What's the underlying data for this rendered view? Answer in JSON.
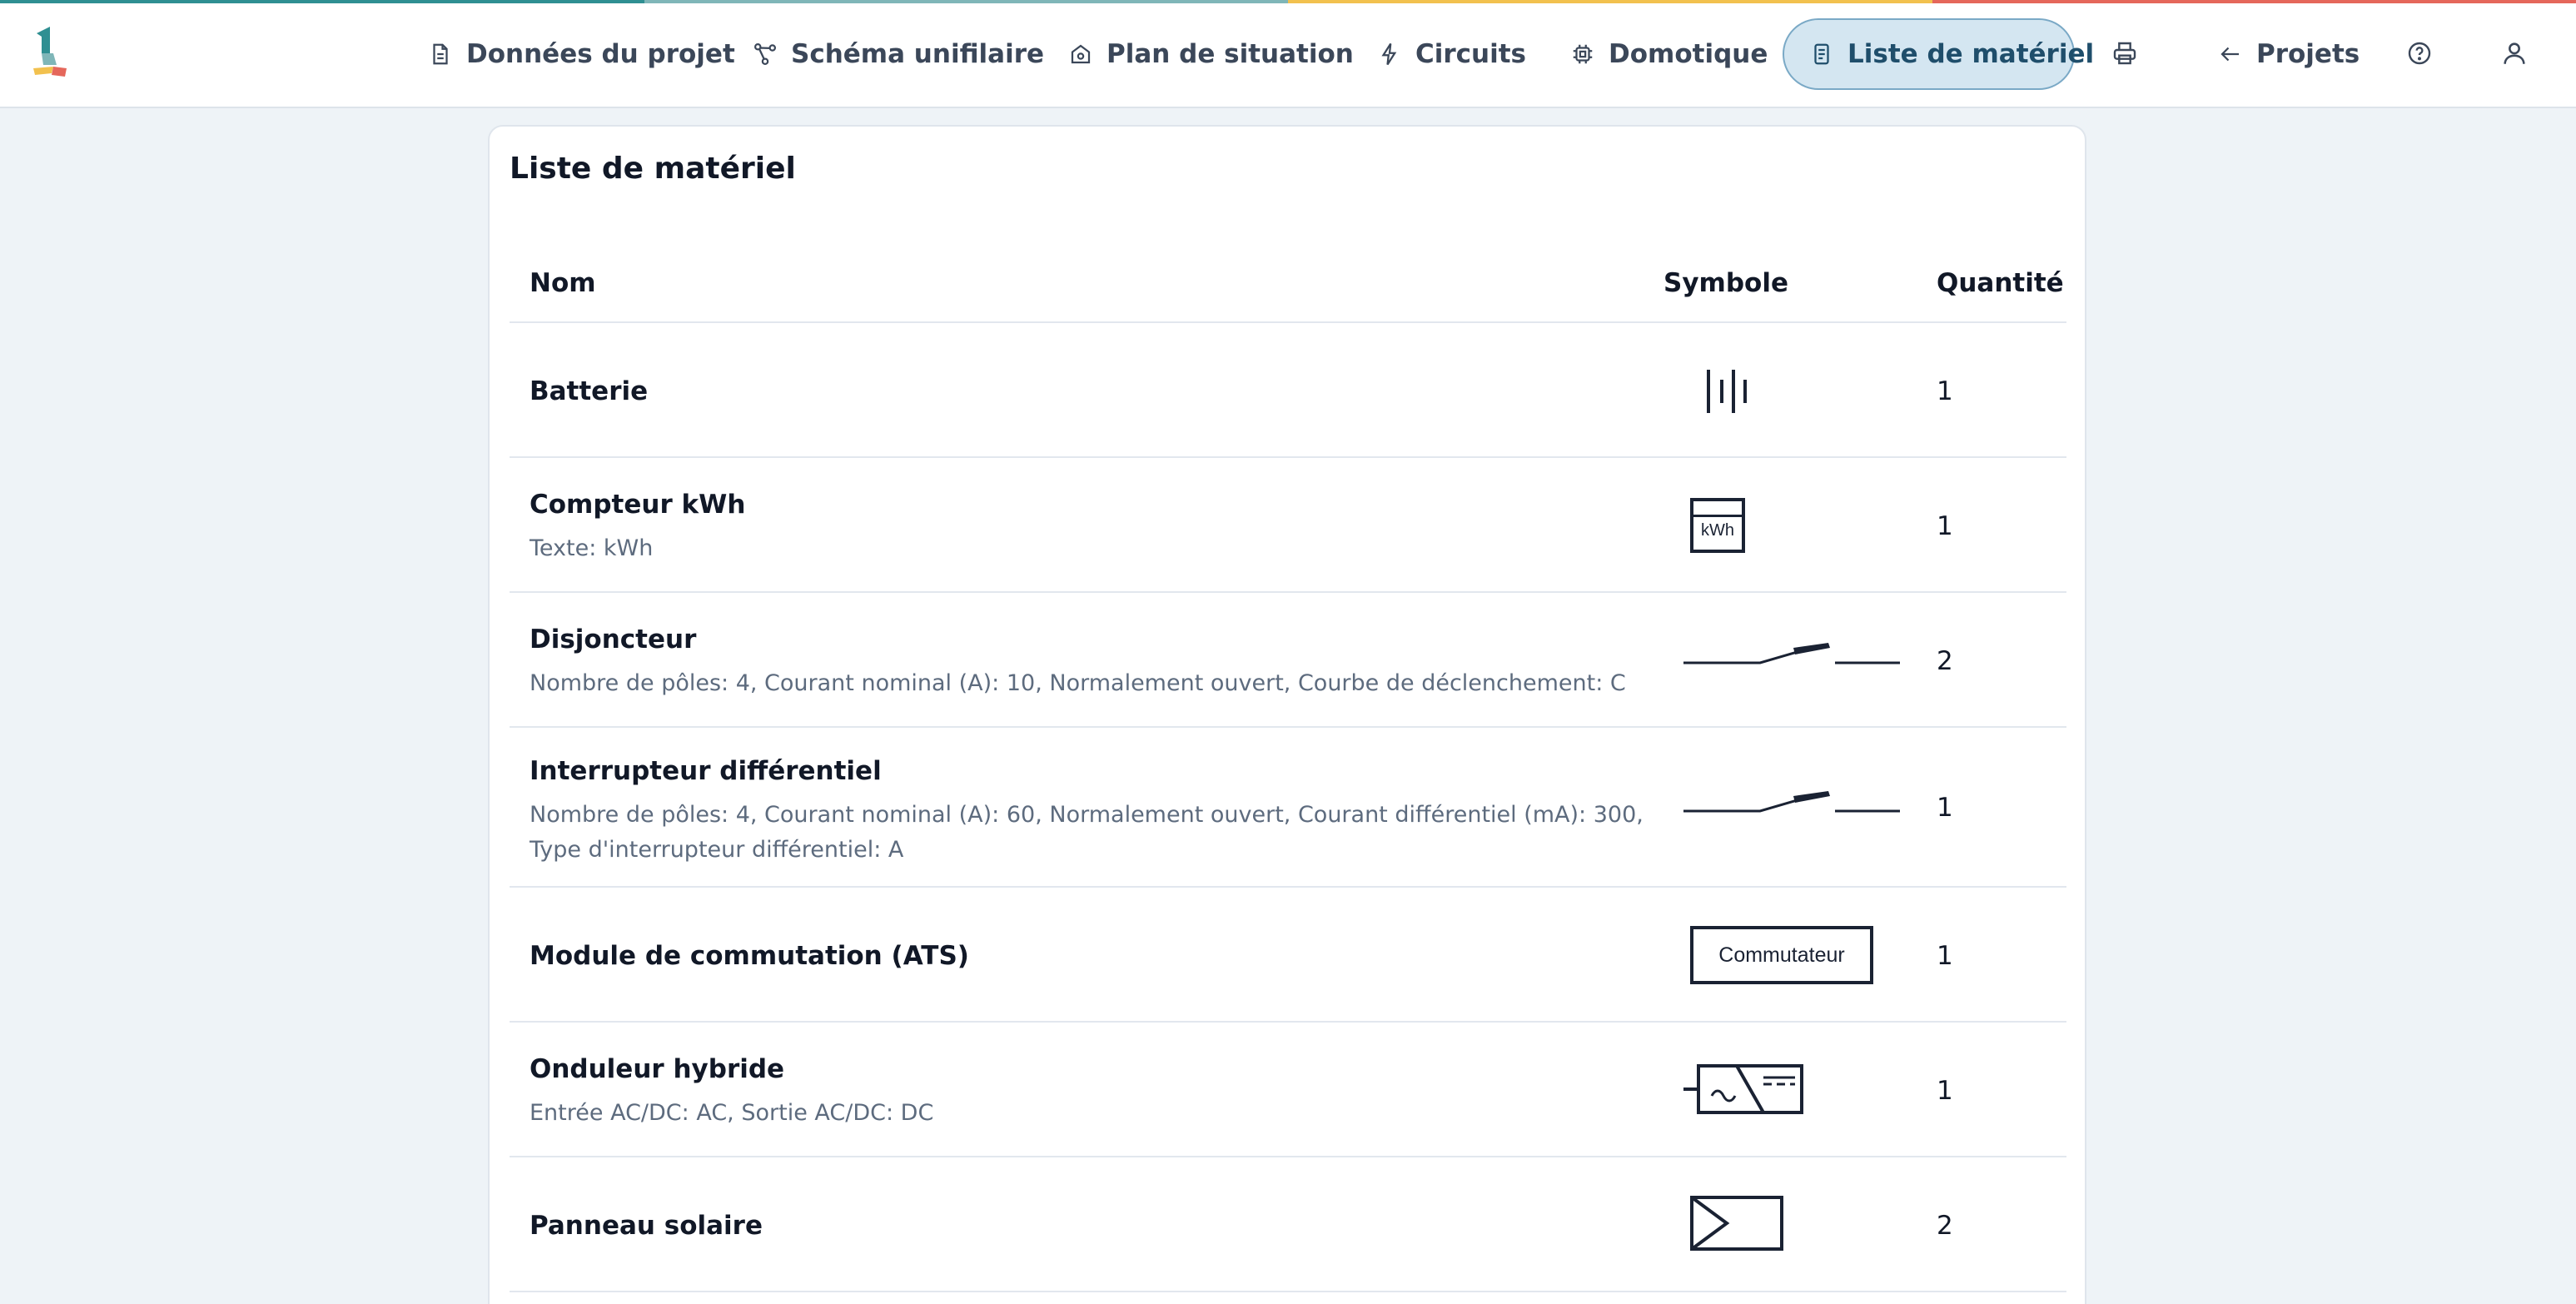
{
  "colors": {
    "accent": "#d4e6f1",
    "accent_border": "#7aa9c6",
    "logo_teal": "#2f8f92",
    "logo_yellow": "#f2c14e",
    "logo_red": "#e5675b"
  },
  "nav": {
    "items": [
      {
        "label": "Données du projet",
        "icon": "document-icon"
      },
      {
        "label": "Schéma unifilaire",
        "icon": "diagram-icon"
      },
      {
        "label": "Plan de situation",
        "icon": "home-icon"
      },
      {
        "label": "Circuits",
        "icon": "bolt-icon"
      },
      {
        "label": "Domotique",
        "icon": "chip-icon"
      },
      {
        "label": "Liste de matériel",
        "icon": "list-icon",
        "active": true
      }
    ],
    "print_icon": "printer-icon",
    "projects_label": "Projets",
    "help_icon": "help-icon",
    "user_icon": "user-icon"
  },
  "material_list": {
    "title": "Liste de matériel",
    "columns": {
      "name": "Nom",
      "symbol": "Symbole",
      "quantity": "Quantité"
    },
    "rows": [
      {
        "name": "Batterie",
        "description": "",
        "symbol": "battery-symbol-icon",
        "quantity": "1"
      },
      {
        "name": "Compteur kWh",
        "description": "Texte: kWh",
        "symbol": "kwh-meter-symbol-icon",
        "symbol_text": "kWh",
        "quantity": "1"
      },
      {
        "name": "Disjoncteur",
        "description": "Nombre de pôles: 4, Courant nominal (A): 10, Normalement ouvert, Courbe de déclenchement: C",
        "symbol": "breaker-symbol-icon",
        "quantity": "2"
      },
      {
        "name": "Interrupteur différentiel",
        "description": "Nombre de pôles: 4, Courant nominal (A): 60, Normalement ouvert, Courant différentiel (mA): 300, Type d'interrupteur différentiel: A",
        "symbol": "rcd-symbol-icon",
        "quantity": "1"
      },
      {
        "name": "Module de commutation (ATS)",
        "description": "",
        "symbol": "switch-module-symbol-icon",
        "symbol_text": "Commutateur",
        "quantity": "1"
      },
      {
        "name": "Onduleur hybride",
        "description": "Entrée AC/DC: AC, Sortie AC/DC: DC",
        "symbol": "inverter-symbol-icon",
        "quantity": "1"
      },
      {
        "name": "Panneau solaire",
        "description": "",
        "symbol": "solar-panel-symbol-icon",
        "quantity": "2"
      }
    ]
  }
}
